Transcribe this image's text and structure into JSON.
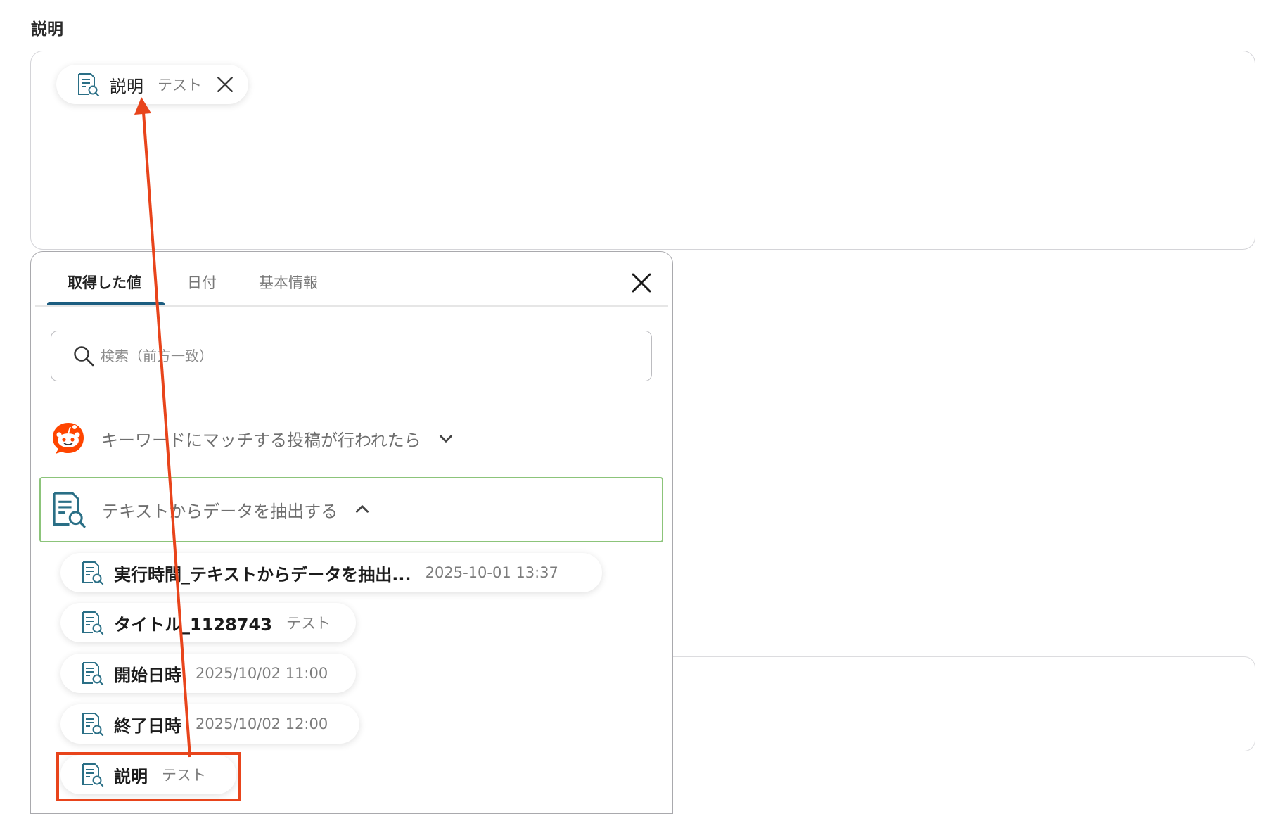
{
  "field": {
    "label": "説明",
    "chip": {
      "name": "説明",
      "value": "テスト",
      "icon": "document-search-icon",
      "remove_icon": "close-icon"
    }
  },
  "popup": {
    "tabs": [
      "取得した値",
      "日付",
      "基本情報"
    ],
    "active_tab": "取得した値",
    "close_icon": "close-icon",
    "search": {
      "placeholder": "検索（前方一致）",
      "icon": "search-icon"
    },
    "groups": [
      {
        "title": "キーワードにマッチする投稿が行われたら",
        "icon": "reddit-logo-icon",
        "expanded": false
      },
      {
        "title": "テキストからデータを抽出する",
        "icon": "document-search-icon",
        "expanded": true
      }
    ],
    "items": [
      {
        "name": "実行時間_テキストからデータを抽出...",
        "value": "2025-10-01 13:37"
      },
      {
        "name": "タイトル_1128743",
        "value": "テスト"
      },
      {
        "name": "開始日時",
        "value": "2025/10/02 11:00"
      },
      {
        "name": "終了日時",
        "value": "2025/10/02 12:00"
      },
      {
        "name": "説明",
        "value": "テスト"
      }
    ]
  },
  "colors": {
    "accent": "#1c5d80",
    "selected_group_border": "#8cc47a",
    "annotation": "#e8441b",
    "reddit": "#ff4500"
  }
}
